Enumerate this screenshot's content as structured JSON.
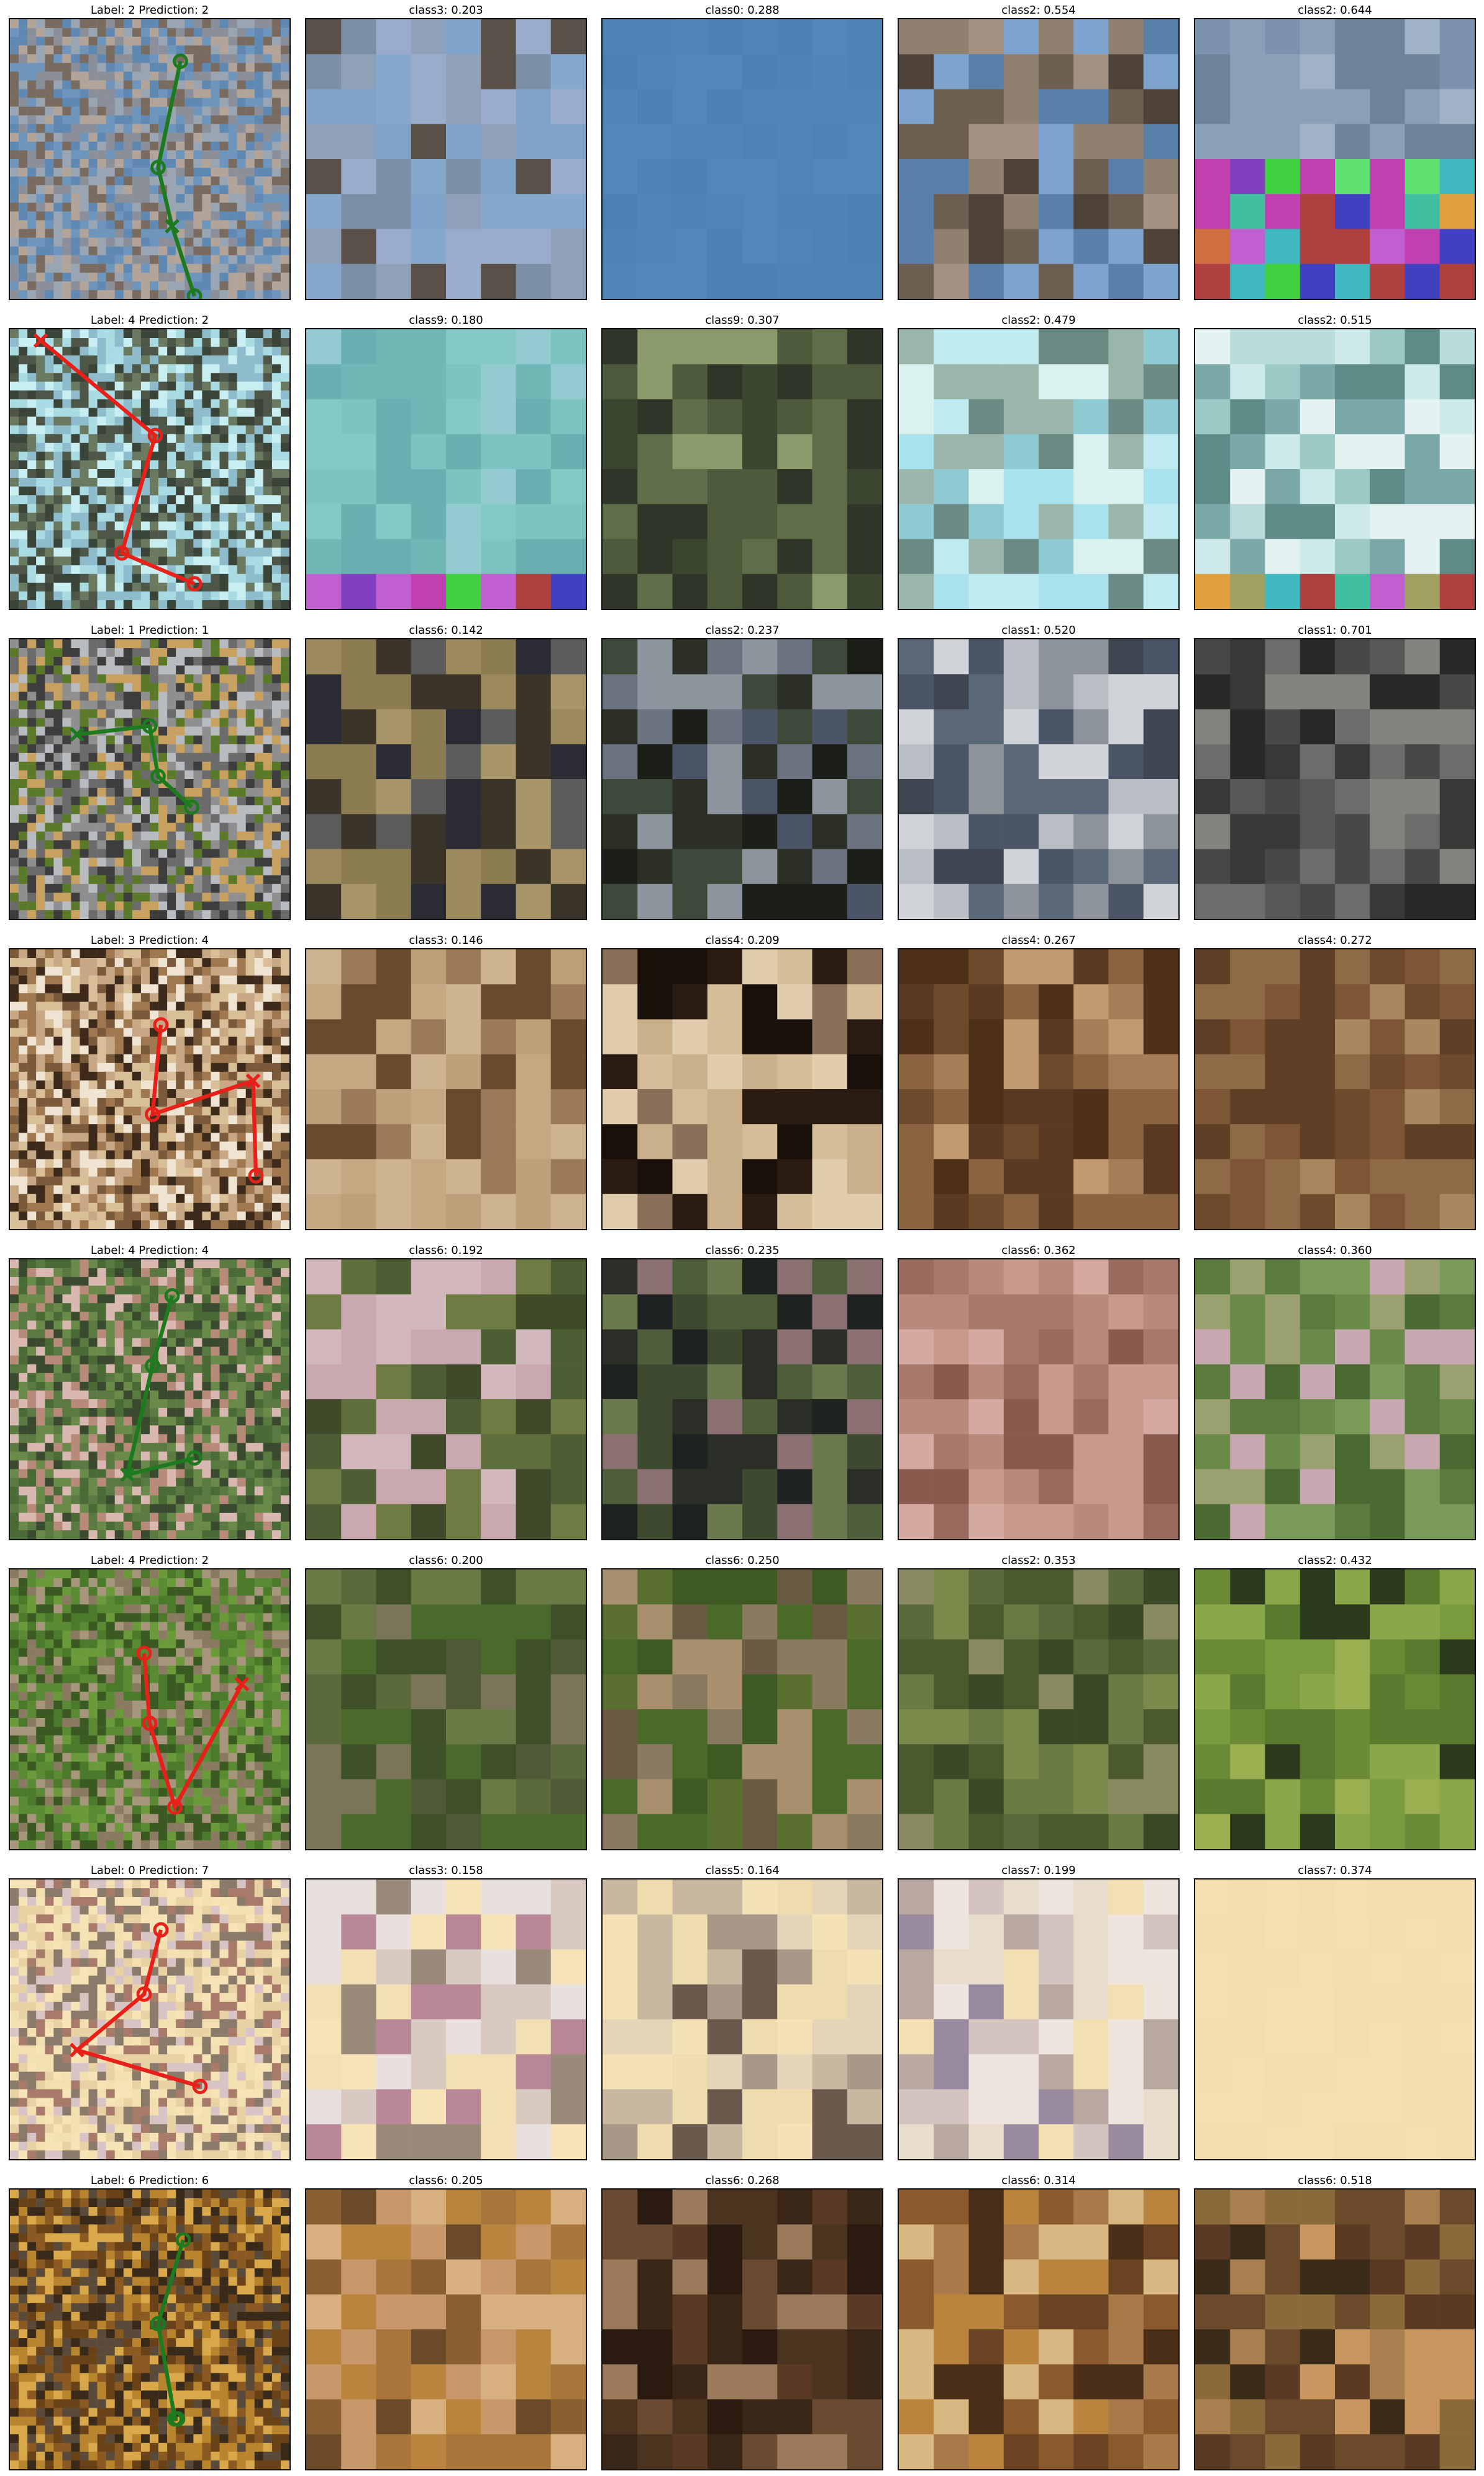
{
  "rows": [
    {
      "label_title": "Label: 2 Prediction: 2",
      "correct": true,
      "main_palette": [
        "#6e95bb",
        "#5f88b3",
        "#8a8f9a",
        "#b3a499",
        "#7a6b60",
        "#9aa5b3"
      ],
      "glimpses": [
        {
          "title": "class3: 0.203",
          "palette": [
            "#7fa3c9",
            "#86a8cc",
            "#8fa0b8",
            "#5b5048",
            "#7b8fa7",
            "#9aaccc"
          ]
        },
        {
          "title": "class0: 0.288",
          "palette": [
            "#4f82b5",
            "#5185b8",
            "#4d80b3",
            "#5386b9"
          ]
        },
        {
          "title": "class2: 0.554",
          "palette": [
            "#8f8070",
            "#6d5e52",
            "#a39283",
            "#5a7fa8",
            "#7fa3cf",
            "#4e4238"
          ]
        },
        {
          "title": "class2: 0.644",
          "palette": [
            "#8aa0b8",
            "#7d93ad",
            "#9fb2c6",
            "#6e8299"
          ],
          "noise_rows": 4
        }
      ]
    },
    {
      "label_title": "Label: 4 Prediction: 2",
      "correct": false,
      "main_palette": [
        "#a9dbe3",
        "#c9eef2",
        "#4e5747",
        "#6a7a60",
        "#8fbccc",
        "#3b4438"
      ],
      "glimpses": [
        {
          "title": "class9: 0.180",
          "palette": [
            "#7cc4c0",
            "#84c9c4",
            "#6fb8b6",
            "#93cbd0",
            "#6ab0b0"
          ],
          "noise_rows": 1
        },
        {
          "title": "class9: 0.307",
          "palette": [
            "#3b4630",
            "#4d5a3c",
            "#5e6e48",
            "#8a9a6a",
            "#2f3628"
          ]
        },
        {
          "title": "class2: 0.479",
          "palette": [
            "#a9e2ec",
            "#bfeaf0",
            "#8fc9d2",
            "#6b8a84",
            "#d9f2f0",
            "#9ab5aa"
          ]
        },
        {
          "title": "class2: 0.515",
          "palette": [
            "#cde9ea",
            "#b8dcdc",
            "#e4f3f2",
            "#7aa9a8",
            "#9cc8c6",
            "#5e8a88"
          ],
          "noise_rows": 1,
          "noise_bottom": true
        }
      ]
    },
    {
      "label_title": "Label: 1 Prediction: 1",
      "correct": true,
      "main_palette": [
        "#5a7a2a",
        "#6b6b6b",
        "#b8bcc0",
        "#8f8f8f",
        "#3d3d3d",
        "#c8a060"
      ],
      "glimpses": [
        {
          "title": "class6: 0.142",
          "palette": [
            "#9b8a5c",
            "#8c7c52",
            "#a8966a",
            "#3a3528",
            "#5c5c5c",
            "#2b2b33"
          ]
        },
        {
          "title": "class2: 0.237",
          "palette": [
            "#2b2f26",
            "#1c1f18",
            "#3d4a3a",
            "#6b7380",
            "#4a5668",
            "#8c959e"
          ]
        },
        {
          "title": "class1: 0.520",
          "palette": [
            "#5a6878",
            "#4a5666",
            "#b8bec4",
            "#8d939a",
            "#3e4652",
            "#d0d4d8"
          ]
        },
        {
          "title": "class1: 0.701",
          "palette": [
            "#4a4846",
            "#3a3836",
            "#6e6c6a",
            "#2a2826",
            "#858380",
            "#5a5856"
          ]
        }
      ]
    },
    {
      "label_title": "Label: 3 Prediction: 4",
      "correct": false,
      "main_palette": [
        "#c8a884",
        "#d9bf98",
        "#7a5a3a",
        "#3d2a1a",
        "#efe4d2",
        "#a07850"
      ],
      "glimpses": [
        {
          "title": "class3: 0.146",
          "palette": [
            "#c4a882",
            "#bda07a",
            "#cdb390",
            "#9a7a58",
            "#6a4a2e"
          ]
        },
        {
          "title": "class4: 0.209",
          "palette": [
            "#d4bd98",
            "#c9b08a",
            "#e0cdae",
            "#2a1c12",
            "#1a100a",
            "#8a7058"
          ]
        },
        {
          "title": "class4: 0.267",
          "palette": [
            "#8a6440",
            "#6e4a2c",
            "#a57d56",
            "#4e3018",
            "#c19a70",
            "#5a3a22"
          ]
        },
        {
          "title": "class4: 0.272",
          "palette": [
            "#6e4a2c",
            "#5e3e24",
            "#7d5636",
            "#8f6a46",
            "#a9875e"
          ]
        }
      ]
    },
    {
      "label_title": "Label: 4 Prediction: 4",
      "correct": true,
      "main_palette": [
        "#4a6a36",
        "#5a7a42",
        "#3a4a2e",
        "#b88a7a",
        "#d8b8b0",
        "#6a8a4a"
      ],
      "glimpses": [
        {
          "title": "class6: 0.192",
          "palette": [
            "#4e5e34",
            "#5e6e3c",
            "#6e7c44",
            "#3e4a2a",
            "#caa8b0",
            "#d2b8bc"
          ]
        },
        {
          "title": "class6: 0.235",
          "palette": [
            "#2a2e26",
            "#3e4a30",
            "#4e5e3a",
            "#1e2220",
            "#6a7a4e",
            "#8a7070"
          ]
        },
        {
          "title": "class6: 0.362",
          "palette": [
            "#a8786a",
            "#b88a7c",
            "#c89a8c",
            "#8a5a4e",
            "#d4aaa0",
            "#9a6a5e"
          ]
        },
        {
          "title": "class4: 0.360",
          "palette": [
            "#6a8a4a",
            "#5a7a3e",
            "#7a9a5a",
            "#4a6a32",
            "#c8a8b0",
            "#9aa070"
          ]
        }
      ]
    },
    {
      "label_title": "Label: 4 Prediction: 2",
      "correct": false,
      "main_palette": [
        "#4a7a2a",
        "#5a8a34",
        "#3a5a22",
        "#8a7a62",
        "#a8967c",
        "#6a9a3a"
      ],
      "glimpses": [
        {
          "title": "class6: 0.200",
          "palette": [
            "#4e5a36",
            "#5a6a3a",
            "#6a7a44",
            "#3e5028",
            "#7a7458",
            "#4a6a2c"
          ]
        },
        {
          "title": "class6: 0.250",
          "palette": [
            "#3e5a22",
            "#4a6a2a",
            "#5a7030",
            "#8a7a62",
            "#a8906e",
            "#6a5a44"
          ]
        },
        {
          "title": "class2: 0.353",
          "palette": [
            "#5a6a3a",
            "#6a7a44",
            "#3a4a26",
            "#8a8a62",
            "#4a5a2e",
            "#7a8a4a"
          ]
        },
        {
          "title": "class2: 0.432",
          "palette": [
            "#7a9a3e",
            "#8aa84a",
            "#6a8a36",
            "#9ab050",
            "#2a3a1a",
            "#5a7a2e"
          ]
        }
      ]
    },
    {
      "label_title": "Label: 0 Prediction: 7",
      "correct": false,
      "main_palette": [
        "#f3e0b0",
        "#f6e4b6",
        "#e8d2a4",
        "#d8c4c4",
        "#a87a6a",
        "#8a7a6a"
      ],
      "glimpses": [
        {
          "title": "class3: 0.158",
          "palette": [
            "#f2e0b4",
            "#f6e4b8",
            "#e8e0dc",
            "#b88898",
            "#d8cac0",
            "#9a8a7a"
          ]
        },
        {
          "title": "class5: 0.164",
          "palette": [
            "#f3e2b6",
            "#efdcae",
            "#a89888",
            "#6a5a4e",
            "#e4d4b8",
            "#c8b8a0"
          ]
        },
        {
          "title": "class7: 0.199",
          "palette": [
            "#f2e0b4",
            "#eee6de",
            "#d4c4c0",
            "#9a8aa0",
            "#b8a8a0",
            "#e8dccc"
          ]
        },
        {
          "title": "class7: 0.374",
          "palette": [
            "#f3dfad",
            "#f2deac",
            "#f4e0ae"
          ]
        }
      ]
    },
    {
      "label_title": "Label: 6 Prediction: 6",
      "correct": true,
      "main_palette": [
        "#8a5a22",
        "#6a4218",
        "#b8842e",
        "#3a2a1a",
        "#d8a84a",
        "#5a4a3a"
      ],
      "glimpses": [
        {
          "title": "class6: 0.205",
          "palette": [
            "#b8843e",
            "#a8763a",
            "#c8986a",
            "#8a6030",
            "#d8b080",
            "#6a4a28"
          ]
        },
        {
          "title": "class6: 0.268",
          "palette": [
            "#3a2616",
            "#2a1a10",
            "#4a3420",
            "#6a4a30",
            "#9a7a5a",
            "#5a3a24"
          ]
        },
        {
          "title": "class6: 0.314",
          "palette": [
            "#6a4422",
            "#8a5a2c",
            "#b8843e",
            "#d8b880",
            "#4a2e18",
            "#a87a4a"
          ]
        },
        {
          "title": "class6: 0.518",
          "palette": [
            "#6a4a2a",
            "#5a3a22",
            "#8a6a3a",
            "#c8965e",
            "#3a2a18",
            "#a88050"
          ]
        }
      ]
    }
  ],
  "colors": {
    "correct": "#1e7a1e",
    "incorrect": "#e8201a",
    "frame": "#111111"
  }
}
